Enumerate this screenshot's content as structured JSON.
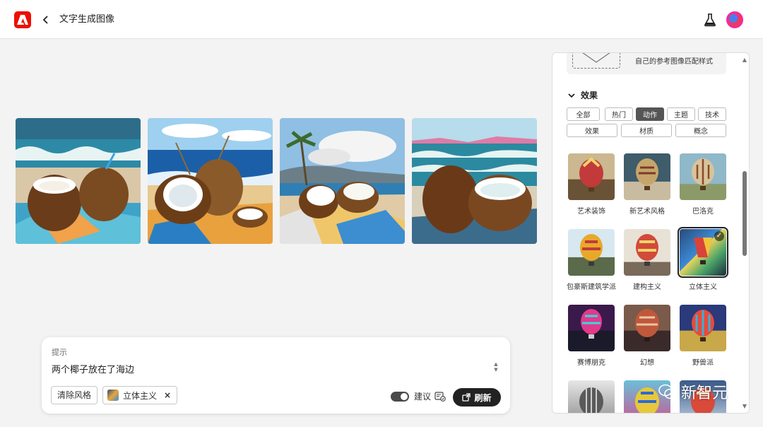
{
  "header": {
    "title": "文字生成图像"
  },
  "prompt": {
    "label": "提示",
    "text": "两个椰子放在了海边",
    "clear_style": "清除风格",
    "style_tag": "立体主义",
    "style_tag_remove": "×",
    "suggest_label": "建议",
    "refresh": "刷新"
  },
  "panel": {
    "reference_hint": "自己的参考图像匹配样式",
    "section_title": "效果",
    "filters_row1": [
      "全部",
      "热门",
      "动作",
      "主题",
      "技术"
    ],
    "filters_row2": [
      "效果",
      "材质",
      "概念"
    ],
    "active_filter": "动作",
    "styles": [
      {
        "label": "艺术装饰"
      },
      {
        "label": "新艺术风格"
      },
      {
        "label": "巴洛克"
      },
      {
        "label": "包豪斯建筑学派"
      },
      {
        "label": "建构主义"
      },
      {
        "label": "立体主义",
        "selected": true
      },
      {
        "label": "赛博朋克"
      },
      {
        "label": "幻想"
      },
      {
        "label": "野兽派"
      }
    ]
  },
  "watermark": "新智元",
  "colors": {
    "brand": "#eb1000",
    "primary_button": "#222222",
    "active_chip": "#555555"
  }
}
